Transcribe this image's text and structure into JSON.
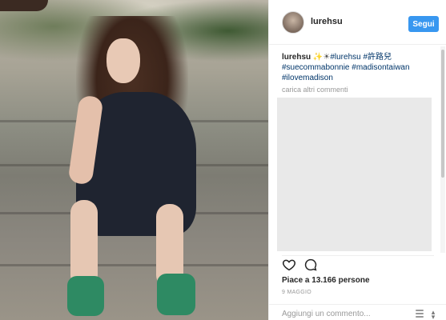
{
  "post": {
    "username": "lurehsu",
    "follow_label": "Segui",
    "caption": {
      "user": "lurehsu",
      "sparkles": "✨☀",
      "tags": [
        "#lurehsu",
        "#許路兒",
        "#suecommabonnie",
        "#madisontaiwan",
        "#ilovemadison"
      ]
    },
    "load_more": "carica altri commenti",
    "likes": "Piace a 13.166 persone",
    "date": "9 MAGGIO",
    "comment_placeholder": "Aggiungi un commento..."
  },
  "icons": {
    "like": "heart-icon",
    "comment": "comment-icon",
    "more": "more-options-icon",
    "resize": "resize-icon"
  },
  "colors": {
    "follow_button": "#3897f0",
    "hashtag": "#003569",
    "muted": "#999999",
    "comment_placeholder_bg": "#e9e9e9"
  }
}
